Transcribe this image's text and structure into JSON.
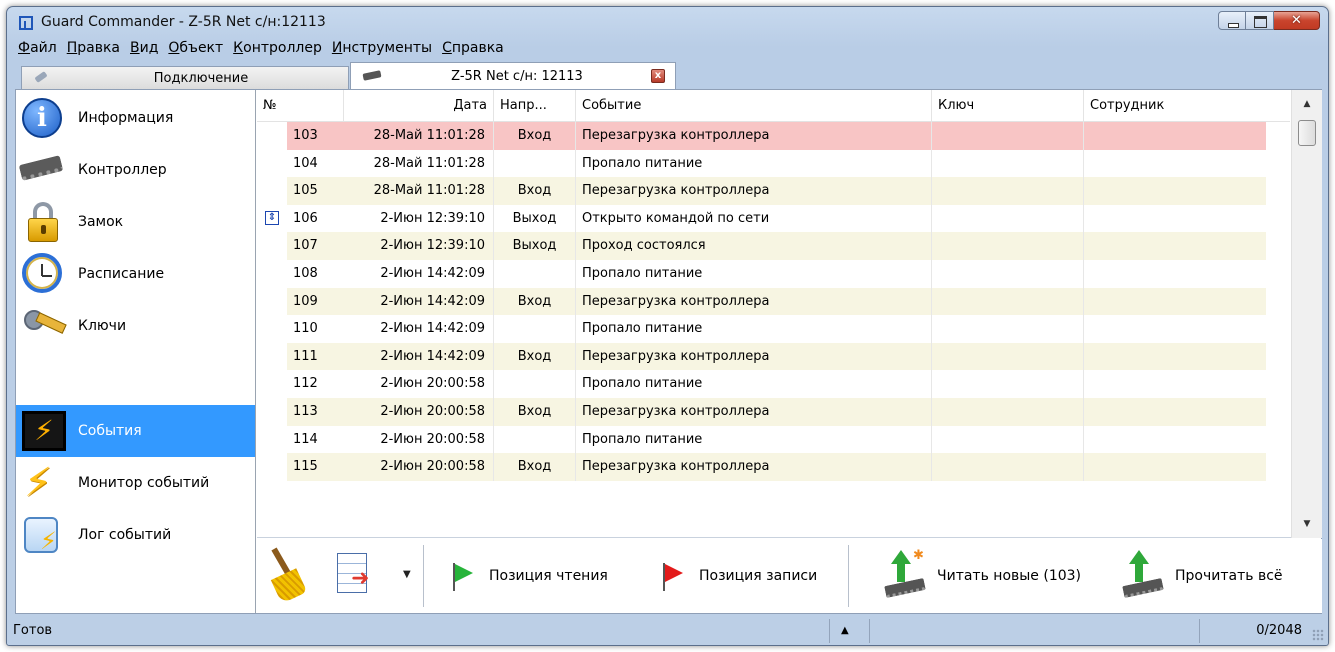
{
  "window": {
    "title": "Guard Commander - Z-5R Net с/н:12113",
    "close_glyph": "✕"
  },
  "menu": [
    {
      "accel": "Ф",
      "rest": "айл"
    },
    {
      "accel": "П",
      "rest": "равка"
    },
    {
      "accel": "В",
      "rest": "ид"
    },
    {
      "accel": "О",
      "rest": "бъект"
    },
    {
      "accel": "К",
      "rest": "онтроллер"
    },
    {
      "accel": "И",
      "rest": "нструменты"
    },
    {
      "accel": "С",
      "rest": "правка"
    }
  ],
  "tabs": [
    {
      "label": "Подключение",
      "icon": "plug-icon"
    },
    {
      "label": "Z-5R Net с/н: 12113",
      "icon": "chip-icon",
      "close": "x"
    }
  ],
  "sidebar": {
    "items": [
      {
        "label": "Информация",
        "icon": "info-icon"
      },
      {
        "label": "Контроллер",
        "icon": "chip-icon"
      },
      {
        "label": "Замок",
        "icon": "lock-icon"
      },
      {
        "label": "Расписание",
        "icon": "clock-icon"
      },
      {
        "label": "Ключи",
        "icon": "keys-icon"
      },
      {
        "label": "События",
        "icon": "events-icon",
        "active": true
      },
      {
        "label": "Монитор событий",
        "icon": "bolt-icon"
      },
      {
        "label": "Лог событий",
        "icon": "log-icon"
      }
    ]
  },
  "grid": {
    "columns": [
      "№",
      "Дата",
      "Напр...",
      "Событие",
      "Ключ",
      "Сотрудник"
    ],
    "rows": [
      {
        "num": "103",
        "date": "28-Май 11:01:28",
        "dir": "Вход",
        "event": "Перезагрузка контроллера",
        "key": "",
        "emp": "",
        "style": "hl"
      },
      {
        "num": "104",
        "date": "28-Май 11:01:28",
        "dir": "",
        "event": "Пропало питание",
        "key": "",
        "emp": "",
        "style": ""
      },
      {
        "num": "105",
        "date": "28-Май 11:01:28",
        "dir": "Вход",
        "event": "Перезагрузка контроллера",
        "key": "",
        "emp": "",
        "style": "alt"
      },
      {
        "num": "106",
        "date": "2-Июн 12:39:10",
        "dir": "Выход",
        "event": "Открыто командой по сети",
        "key": "",
        "emp": "",
        "style": "",
        "mark": "⇕"
      },
      {
        "num": "107",
        "date": "2-Июн 12:39:10",
        "dir": "Выход",
        "event": "Проход состоялся",
        "key": "",
        "emp": "",
        "style": "alt"
      },
      {
        "num": "108",
        "date": "2-Июн 14:42:09",
        "dir": "",
        "event": "Пропало питание",
        "key": "",
        "emp": "",
        "style": ""
      },
      {
        "num": "109",
        "date": "2-Июн 14:42:09",
        "dir": "Вход",
        "event": "Перезагрузка контроллера",
        "key": "",
        "emp": "",
        "style": "alt"
      },
      {
        "num": "110",
        "date": "2-Июн 14:42:09",
        "dir": "",
        "event": "Пропало питание",
        "key": "",
        "emp": "",
        "style": ""
      },
      {
        "num": "111",
        "date": "2-Июн 14:42:09",
        "dir": "Вход",
        "event": "Перезагрузка контроллера",
        "key": "",
        "emp": "",
        "style": "alt"
      },
      {
        "num": "112",
        "date": "2-Июн 20:00:58",
        "dir": "",
        "event": "Пропало питание",
        "key": "",
        "emp": "",
        "style": ""
      },
      {
        "num": "113",
        "date": "2-Июн 20:00:58",
        "dir": "Вход",
        "event": "Перезагрузка контроллера",
        "key": "",
        "emp": "",
        "style": "alt"
      },
      {
        "num": "114",
        "date": "2-Июн 20:00:58",
        "dir": "",
        "event": "Пропало питание",
        "key": "",
        "emp": "",
        "style": ""
      },
      {
        "num": "115",
        "date": "2-Июн 20:00:58",
        "dir": "Вход",
        "event": "Перезагрузка контроллера",
        "key": "",
        "emp": "",
        "style": "alt"
      }
    ]
  },
  "scrollbar": {
    "up": "▲",
    "down": "▼"
  },
  "toolbar": {
    "dropdown_glyph": "▼",
    "read_pos_label": "Позиция чтения",
    "write_pos_label": "Позиция записи",
    "read_new_label": "Читать новые (103)",
    "read_all_label": "Прочитать всё"
  },
  "status": {
    "ready": "Готов",
    "arrow": "▲",
    "count": "0/2048"
  }
}
